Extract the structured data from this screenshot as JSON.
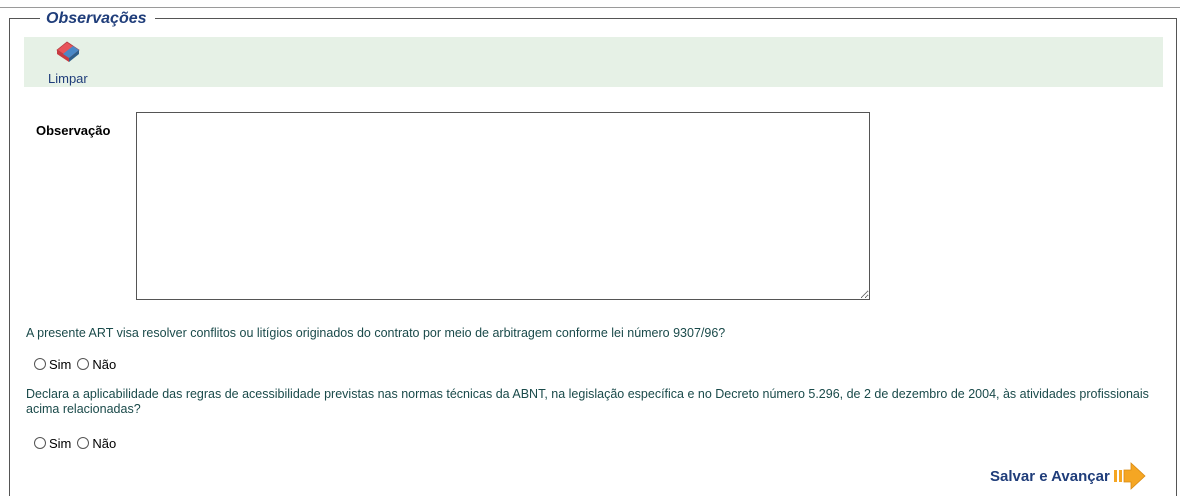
{
  "section": {
    "legend": "Observações"
  },
  "toolbar": {
    "clear_label": "Limpar",
    "clear_icon": "eraser-icon"
  },
  "observation": {
    "label": "Observação",
    "value": ""
  },
  "questions": [
    {
      "text": "A presente ART visa resolver conflitos ou litígios originados do contrato por meio de arbitragem conforme lei número 9307/96?",
      "options": [
        "Sim",
        "Não"
      ],
      "selected": null
    },
    {
      "text": "Declara a aplicabilidade das regras de acessibilidade previstas nas normas técnicas da ABNT, na legislação específica e no Decreto número 5.296, de 2 de dezembro de 2004, às atividades profissionais acima relacionadas?",
      "options": [
        "Sim",
        "Não"
      ],
      "selected": null
    }
  ],
  "actions": {
    "save_next_label": "Salvar e Avançar",
    "save_next_icon": "arrow-right-icon"
  },
  "colors": {
    "accent": "#1f3d7a",
    "toolbar_bg": "#e6f1e6",
    "question_text": "#1a4a4a",
    "arrow": "#f5a623"
  }
}
